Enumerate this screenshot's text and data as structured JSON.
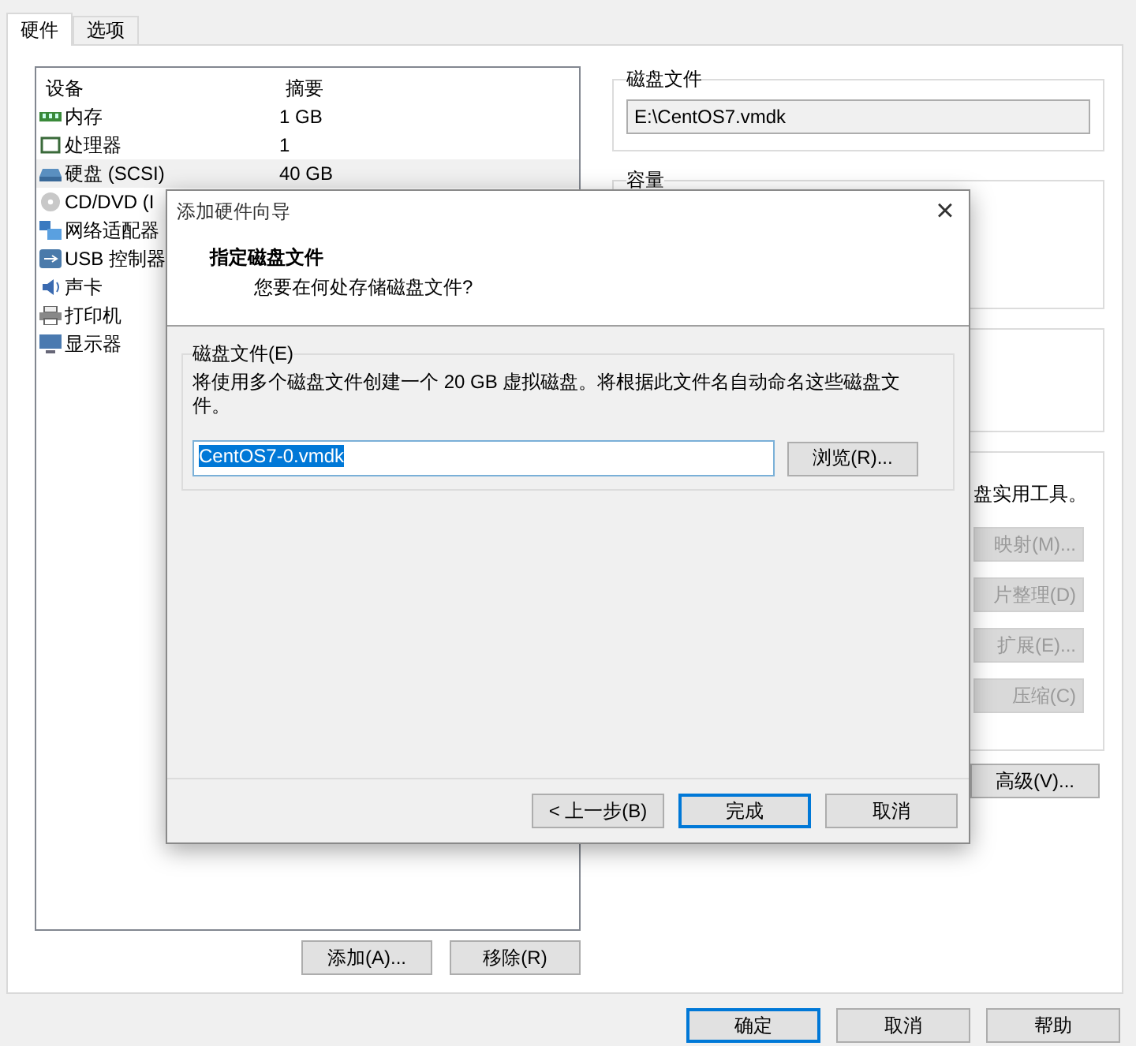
{
  "tabs": [
    {
      "label": "硬件",
      "selected": true
    },
    {
      "label": "选项",
      "selected": false
    }
  ],
  "device_list": {
    "columns": [
      "设备",
      "摘要"
    ],
    "rows": [
      {
        "kind": "memory",
        "device": "内存",
        "summary": "1 GB",
        "selected": false
      },
      {
        "kind": "cpu",
        "device": "处理器",
        "summary": "1",
        "selected": false
      },
      {
        "kind": "disk",
        "device": "硬盘 (SCSI)",
        "summary": "40 GB",
        "selected": true
      },
      {
        "kind": "cd",
        "device": "CD/DVD (I",
        "selected": false
      },
      {
        "kind": "network",
        "device": "网络适配器",
        "selected": false
      },
      {
        "kind": "usb",
        "device": "USB 控制器",
        "selected": false
      },
      {
        "kind": "sound",
        "device": "声卡",
        "selected": false
      },
      {
        "kind": "printer",
        "device": "打印机",
        "selected": false
      },
      {
        "kind": "display",
        "device": "显示器",
        "selected": false
      }
    ]
  },
  "device_buttons": [
    "添加(A)...",
    "移除(R)"
  ],
  "disk_file": {
    "label": "磁盘文件",
    "value": "E:\\CentOS7.vmdk"
  },
  "capacity": {
    "label": "容量"
  },
  "utilities": {
    "text": "盘实用工具。",
    "buttons": [
      {
        "label": "映射(M)...",
        "disabled": true
      },
      {
        "label": "片整理(D)",
        "disabled": true
      },
      {
        "label": "扩展(E)...",
        "disabled": true
      },
      {
        "label": "压缩(C)",
        "disabled": true
      }
    ]
  },
  "advanced_button": {
    "label": "高级(V)...",
    "disabled": false
  },
  "footer_buttons": [
    {
      "label": "确定",
      "default": true
    },
    {
      "label": "取消",
      "default": false
    },
    {
      "label": "帮助",
      "default": false
    }
  ],
  "dialog": {
    "title": "添加硬件向导",
    "close": "×",
    "heading": "指定磁盘文件",
    "subheading": "您要在何处存储磁盘文件?",
    "group_label": "磁盘文件(E)",
    "description": "将使用多个磁盘文件创建一个 20 GB 虚拟磁盘。将根据此文件名自动命名这些磁盘文件。",
    "file_field": {
      "value": "CentOS7-0.vmdk",
      "value_selected": true
    },
    "browse_button": "浏览(R)...",
    "buttons": [
      {
        "label": "< 上一步(B)",
        "default": false
      },
      {
        "label": "完成",
        "default": true
      },
      {
        "label": "取消",
        "default": false
      }
    ]
  }
}
